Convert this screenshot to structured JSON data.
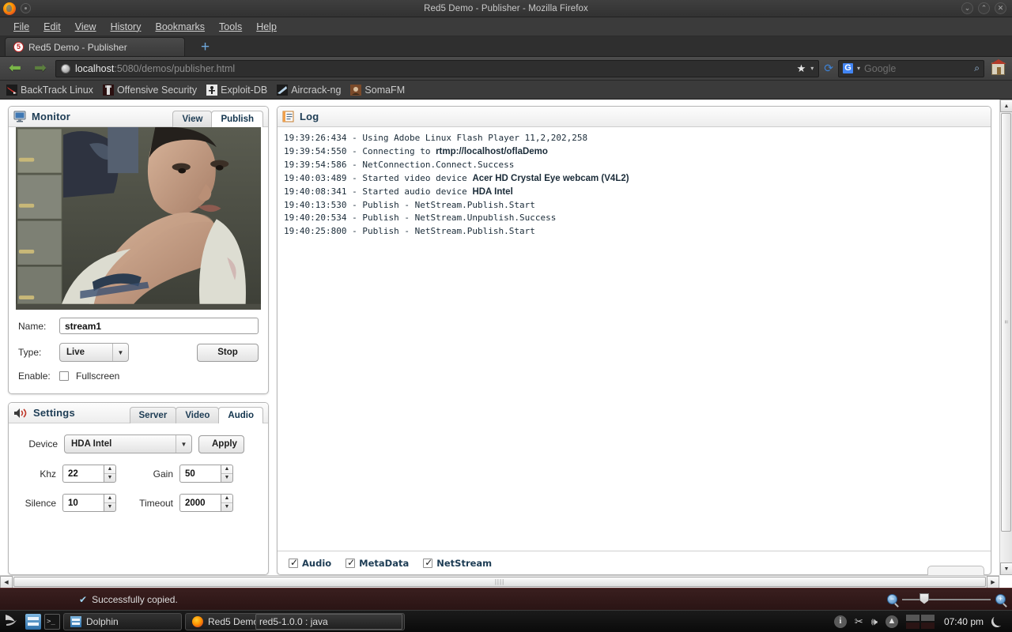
{
  "window": {
    "title": "Red5 Demo - Publisher - Mozilla Firefox",
    "minimize": "⌄",
    "maximize": "⌃",
    "close": "✕"
  },
  "menubar": {
    "items": [
      "File",
      "Edit",
      "View",
      "History",
      "Bookmarks",
      "Tools",
      "Help"
    ]
  },
  "tabbar": {
    "tab_title": "Red5 Demo - Publisher",
    "favicon_label": "5",
    "newtab_label": "+"
  },
  "navbar": {
    "back_icon": "⬅",
    "forward_icon": "➡",
    "url_host": "localhost",
    "url_path": ":5080/demos/publisher.html",
    "star_icon": "★",
    "caret_icon": "▾",
    "reload_icon": "⟳",
    "search_engine_label": "G",
    "search_placeholder": "Google",
    "search_icon": "⌕"
  },
  "bookmarks": [
    {
      "label": "BackTrack Linux"
    },
    {
      "label": "Offensive Security"
    },
    {
      "label": "Exploit-DB"
    },
    {
      "label": "Aircrack-ng"
    },
    {
      "label": "SomaFM"
    }
  ],
  "monitor": {
    "title": "Monitor",
    "tabs": [
      {
        "label": "View",
        "active": false
      },
      {
        "label": "Publish",
        "active": true
      }
    ],
    "name_label": "Name:",
    "name_value": "stream1",
    "type_label": "Type:",
    "type_value": "Live",
    "stop_button": "Stop",
    "enable_label": "Enable:",
    "fullscreen_label": "Fullscreen",
    "fullscreen_checked": false
  },
  "settings": {
    "title": "Settings",
    "tabs": [
      {
        "label": "Server",
        "active": false
      },
      {
        "label": "Video",
        "active": false
      },
      {
        "label": "Audio",
        "active": true
      }
    ],
    "device_label": "Device",
    "device_value": "HDA Intel",
    "apply_button": "Apply",
    "fields": [
      {
        "label": "Khz",
        "value": "22"
      },
      {
        "label": "Gain",
        "value": "50"
      },
      {
        "label": "Silence",
        "value": "10"
      },
      {
        "label": "Timeout",
        "value": "2000"
      }
    ]
  },
  "log": {
    "title": "Log",
    "lines": [
      {
        "time": "19:39:26:434",
        "text": " - Using Adobe Linux Flash Player 11,2,202,258",
        "bold": ""
      },
      {
        "time": "19:39:54:550",
        "text": " - Connecting to ",
        "bold": "rtmp://localhost/oflaDemo"
      },
      {
        "time": "19:39:54:586",
        "text": " - NetConnection.Connect.Success",
        "bold": ""
      },
      {
        "time": "19:40:03:489",
        "text": " - Started video device ",
        "bold": "Acer HD Crystal Eye webcam (V4L2)"
      },
      {
        "time": "19:40:08:341",
        "text": " - Started audio device ",
        "bold": "HDA Intel"
      },
      {
        "time": "19:40:13:530",
        "text": " - Publish - NetStream.Publish.Start",
        "bold": ""
      },
      {
        "time": "19:40:20:534",
        "text": " - Publish - NetStream.Unpublish.Success",
        "bold": ""
      },
      {
        "time": "19:40:25:800",
        "text": " - Publish - NetStream.Publish.Start",
        "bold": ""
      }
    ],
    "filters": [
      {
        "label": "Audio",
        "checked": true
      },
      {
        "label": "MetaData",
        "checked": true
      },
      {
        "label": "NetStream",
        "checked": true
      }
    ]
  },
  "statusbar": {
    "message": "Successfully copied.",
    "check_icon": "✔",
    "zoom_out_icon": "−",
    "zoom_in_icon": "+"
  },
  "taskbar": {
    "menu_icon": "K",
    "quicklaunch": [
      {
        "name": "file-manager"
      },
      {
        "name": "terminal"
      }
    ],
    "windows": [
      {
        "label": "Dolphin"
      },
      {
        "label": "Red5 Demo - Publisher"
      },
      {
        "label": "red5-1.0.0 : java"
      }
    ],
    "tray": [
      {
        "name": "info",
        "glyph": "i"
      },
      {
        "name": "scissors",
        "glyph": "✂"
      },
      {
        "name": "volume",
        "glyph": "🕪"
      },
      {
        "name": "eject",
        "glyph": "▲"
      }
    ],
    "clock": "07:40 pm"
  },
  "colors": {
    "panel_title": "#1d3c54",
    "log_text": "#1a2b38",
    "chrome_bg": "#3b3b3b",
    "status_bg": "#2a1414"
  }
}
